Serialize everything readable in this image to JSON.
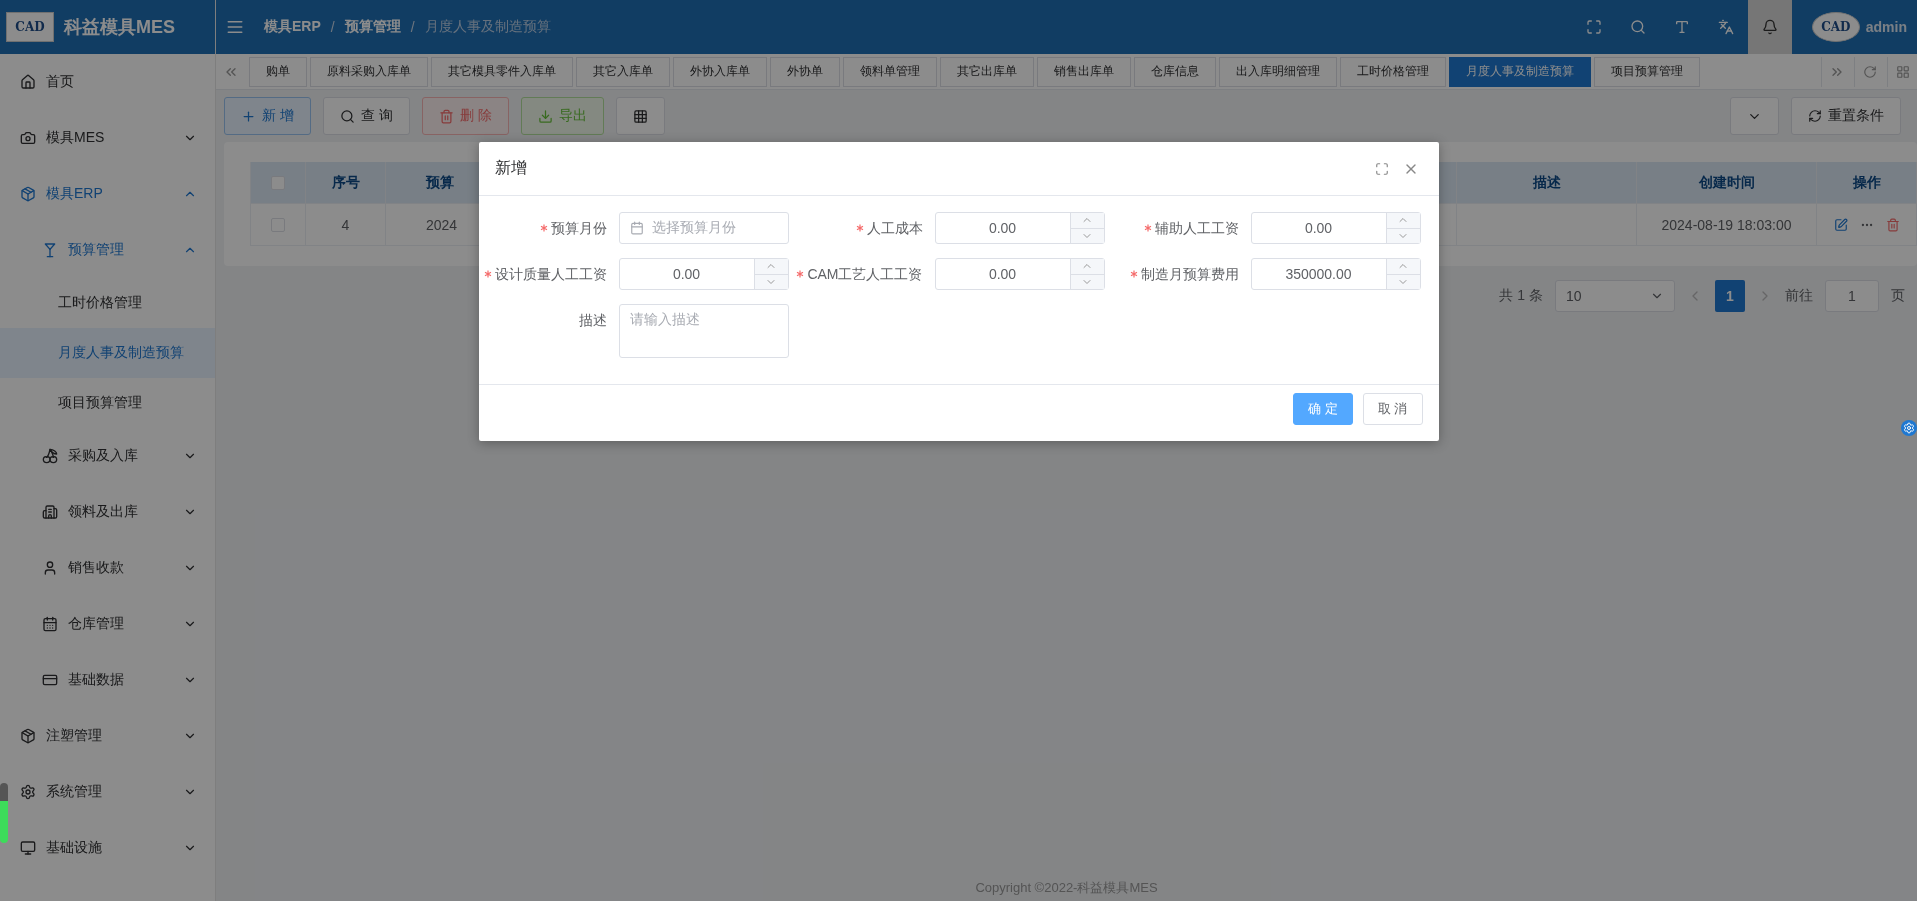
{
  "app": {
    "logo": "CAD",
    "title": "科益模具MES"
  },
  "header": {
    "breadcrumb": [
      "模具ERP",
      "预算管理",
      "月度人事及制造预算"
    ],
    "separators": [
      "/",
      "/"
    ],
    "avatar_logo": "CAD",
    "user": "admin"
  },
  "sidebar": {
    "items": [
      {
        "label": "首页",
        "selected": false
      },
      {
        "label": "模具MES",
        "selected": false,
        "expanded": false
      },
      {
        "label": "模具ERP",
        "selected": true,
        "expanded": true,
        "children": [
          {
            "label": "预算管理",
            "selected": true,
            "expanded": true,
            "children": [
              {
                "label": "工时价格管理",
                "selected": false
              },
              {
                "label": "月度人事及制造预算",
                "selected": true
              },
              {
                "label": "项目预算管理",
                "selected": false
              }
            ]
          },
          {
            "label": "采购及入库",
            "selected": false,
            "expanded": false
          },
          {
            "label": "领料及出库",
            "selected": false,
            "expanded": false
          },
          {
            "label": "销售收款",
            "selected": false,
            "expanded": false
          },
          {
            "label": "仓库管理",
            "selected": false,
            "expanded": false
          },
          {
            "label": "基础数据",
            "selected": false,
            "expanded": false
          }
        ]
      },
      {
        "label": "注塑管理",
        "selected": false,
        "expanded": false
      },
      {
        "label": "系统管理",
        "selected": false,
        "expanded": false
      },
      {
        "label": "基础设施",
        "selected": false,
        "expanded": false
      }
    ]
  },
  "tabs": [
    {
      "label": "购单",
      "selected": false
    },
    {
      "label": "原料采购入库单",
      "selected": false
    },
    {
      "label": "其它模具零件入库单",
      "selected": false
    },
    {
      "label": "其它入库单",
      "selected": false
    },
    {
      "label": "外协入库单",
      "selected": false
    },
    {
      "label": "外协单",
      "selected": false
    },
    {
      "label": "领料单管理",
      "selected": false
    },
    {
      "label": "其它出库单",
      "selected": false
    },
    {
      "label": "销售出库单",
      "selected": false
    },
    {
      "label": "仓库信息",
      "selected": false
    },
    {
      "label": "出入库明细管理",
      "selected": false
    },
    {
      "label": "工时价格管理",
      "selected": false
    },
    {
      "label": "月度人事及制造预算",
      "selected": true
    },
    {
      "label": "项目预算管理",
      "selected": false
    }
  ],
  "toolbar": {
    "buttons": [
      {
        "kind": "add",
        "label": "新 增"
      },
      {
        "kind": "query",
        "label": "查 询"
      },
      {
        "kind": "delete",
        "label": "删 除"
      },
      {
        "kind": "export",
        "label": "导出"
      },
      {
        "kind": "columns"
      }
    ],
    "reset": "重置条件"
  },
  "table": {
    "columns": [
      "序号",
      "预算",
      "描述",
      "创建时间",
      "操作"
    ],
    "all_checked": false,
    "rows": [
      {
        "checked": false,
        "cells": [
          "4",
          "2024",
          "",
          "2024-08-19 18:03:00"
        ]
      }
    ]
  },
  "pagination": {
    "total": "共 1 条",
    "page_size": "10",
    "pages": [
      {
        "label": "1",
        "selected": true
      }
    ],
    "goto": "前往",
    "goto_value": "1",
    "suffix": "页"
  },
  "footer": "Copyright ©2022-科益模具MES",
  "dialog": {
    "title": "新增",
    "fields": [
      {
        "label": "预算月份",
        "required": true,
        "kind": "date",
        "placeholder": "选择预算月份"
      },
      {
        "label": "人工成本",
        "required": true,
        "kind": "number",
        "value": "0.00"
      },
      {
        "label": "辅助人工工资",
        "required": true,
        "kind": "number",
        "value": "0.00"
      },
      {
        "label": "设计质量人工工资",
        "required": true,
        "kind": "number",
        "value": "0.00"
      },
      {
        "label": "CAM工艺人工工资",
        "required": true,
        "kind": "number",
        "value": "0.00"
      },
      {
        "label": "制造月预算费用",
        "required": true,
        "kind": "number",
        "value": "350000.00"
      },
      {
        "label": "描述",
        "required": false,
        "kind": "textarea",
        "placeholder": "请输入描述"
      }
    ],
    "buttons": [
      {
        "kind": "primary",
        "label": "确 定"
      },
      {
        "kind": "default",
        "label": "取 消"
      }
    ]
  }
}
